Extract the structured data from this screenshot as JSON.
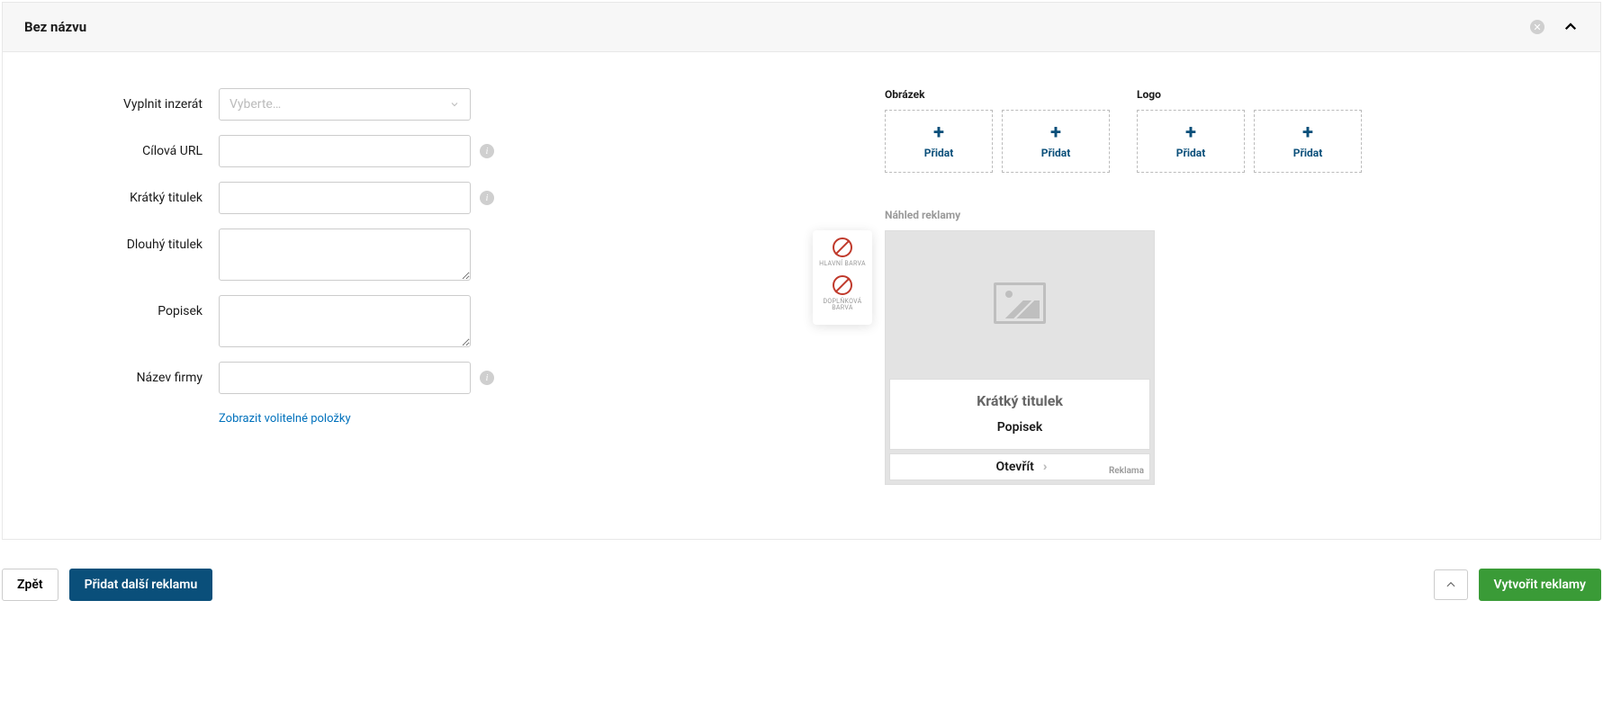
{
  "header": {
    "title": "Bez názvu"
  },
  "form": {
    "fill_ad": {
      "label": "Vyplnit inzerát",
      "placeholder": "Vyberte…"
    },
    "target_url": {
      "label": "Cílová URL",
      "value": ""
    },
    "short_title": {
      "label": "Krátký titulek",
      "value": ""
    },
    "long_title": {
      "label": "Dlouhý titulek",
      "value": ""
    },
    "description": {
      "label": "Popisek",
      "value": ""
    },
    "company": {
      "label": "Název firmy",
      "value": ""
    },
    "optional_link": "Zobrazit volitelné položky"
  },
  "media": {
    "image_label": "Obrázek",
    "logo_label": "Logo",
    "add_label": "Přidat"
  },
  "preview": {
    "section_label": "Náhled reklamy",
    "colors": {
      "primary_label": "HLAVNÍ BARVA",
      "secondary_label": "DOPLŇKOVÁ BARVA"
    },
    "card": {
      "title": "Krátký titulek",
      "description": "Popisek",
      "cta": "Otevřít",
      "ad_tag": "Reklama"
    }
  },
  "footer": {
    "back": "Zpět",
    "add_another": "Přidat další reklamu",
    "create": "Vytvořit reklamy"
  }
}
